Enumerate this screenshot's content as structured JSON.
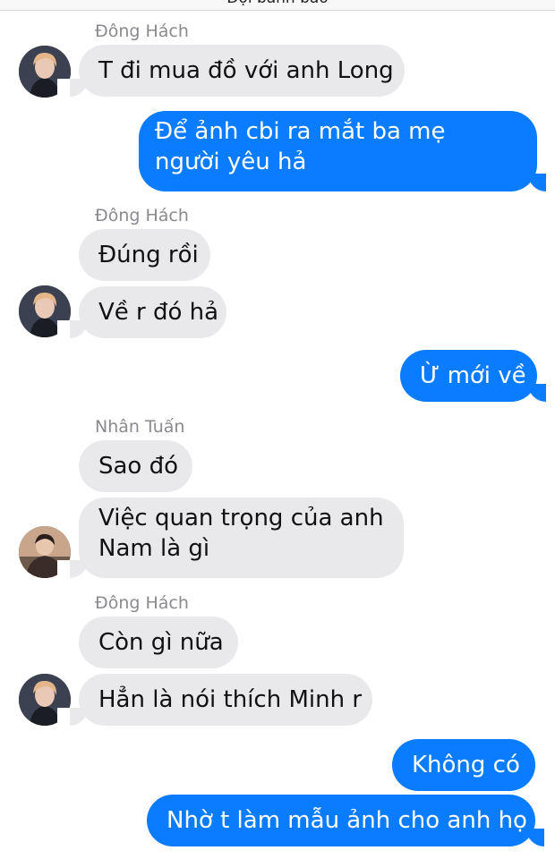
{
  "header": {
    "title": "Đội bánh bao"
  },
  "messages": [
    {
      "sender": "Đông Hách",
      "text": "T đi mua đồ với anh Long"
    },
    {
      "text": "Để ảnh cbi ra mắt ba mẹ người yêu hả"
    },
    {
      "sender": "Đông Hách",
      "text": "Đúng rồi"
    },
    {
      "text": "Về r đó hả"
    },
    {
      "text": "Ừ mới về"
    },
    {
      "sender": "Nhân Tuấn",
      "text": "Sao đó"
    },
    {
      "text": "Việc quan trọng của anh Nam là gì"
    },
    {
      "sender": "Đông Hách",
      "text": "Còn gì nữa"
    },
    {
      "text": "Hẳn là nói thích Minh r"
    },
    {
      "text": "Không có"
    },
    {
      "text": "Nhờ t làm mẫu ảnh cho anh họ"
    }
  ]
}
